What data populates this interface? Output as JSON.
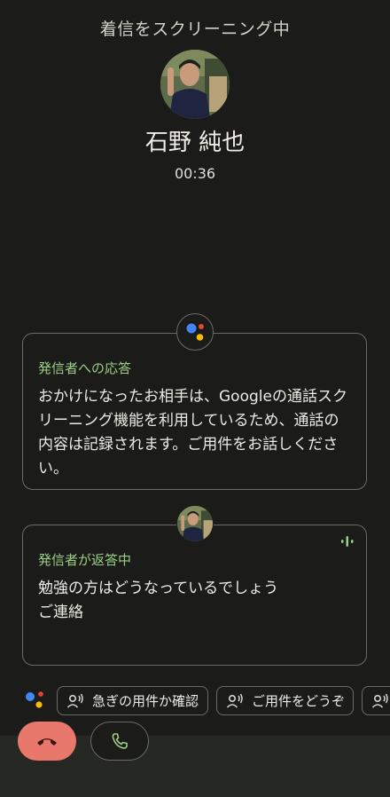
{
  "header": {
    "title": "着信をスクリーニング中"
  },
  "caller": {
    "name": "石野 純也",
    "timer": "00:36",
    "avatar_icon": "caller-photo"
  },
  "cards": {
    "response": {
      "title": "発信者への応答",
      "body": "おかけになったお相手は、Googleの通話スクリーニング機能を利用しているため、通話の内容は記録されます。ご用件をお話しください。",
      "badge_icon": "google-assistant-icon"
    },
    "caller_reply": {
      "title": "発信者が返答中",
      "body": "勉強の方はどうなっているでしょう\nご連絡",
      "status_icon": "speaking-indicator-icon"
    }
  },
  "quick_replies": [
    {
      "label": "急ぎの用件か確認",
      "icon": "voice-person-icon"
    },
    {
      "label": "ご用件をどうぞ",
      "icon": "voice-person-icon"
    },
    {
      "label": "",
      "icon": "voice-person-icon"
    }
  ],
  "actions": {
    "hangup_icon": "hang-up-icon",
    "answer_icon": "phone-icon"
  },
  "colors": {
    "background": "#1b1c19",
    "accent_green": "#9bcf86",
    "hangup_red": "#e8786c",
    "border": "#6b6d62",
    "google_blue": "#4285F4",
    "google_red": "#EA4335",
    "google_yellow": "#FBBC05",
    "google_green": "#34A853"
  }
}
